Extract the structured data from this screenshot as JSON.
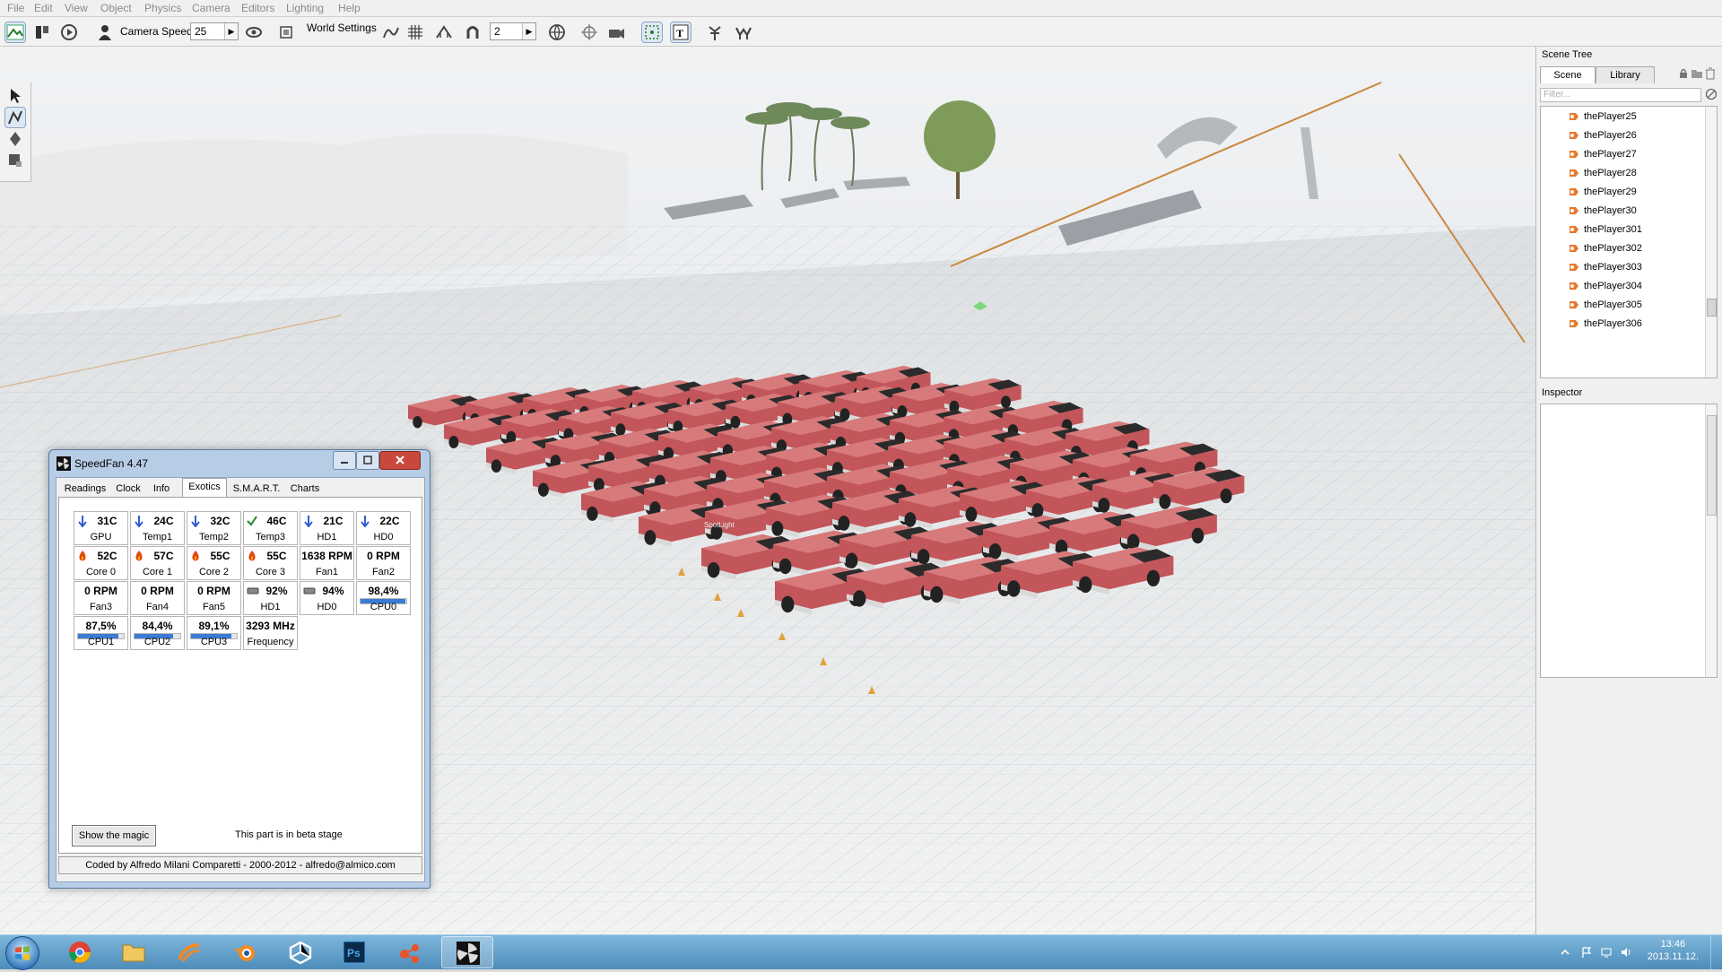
{
  "menu": [
    "File",
    "Edit",
    "View",
    "Object",
    "Physics",
    "Camera",
    "Editors",
    "Lighting",
    "Help"
  ],
  "toolbar": {
    "camera_speed_label": "Camera Speed",
    "camera_speed_value": "25",
    "world_settings_label": "World Settings",
    "grid_value": "2"
  },
  "viewport": {
    "light_label": "SpotLight"
  },
  "scene_tree": {
    "title": "Scene Tree",
    "tabs": [
      "Scene",
      "Library"
    ],
    "filter_placeholder": "Filter...",
    "items": [
      "thePlayer25",
      "thePlayer26",
      "thePlayer27",
      "thePlayer28",
      "thePlayer29",
      "thePlayer30",
      "thePlayer301",
      "thePlayer302",
      "thePlayer303",
      "thePlayer304",
      "thePlayer305",
      "thePlayer306"
    ]
  },
  "inspector": {
    "title": "Inspector"
  },
  "speedfan": {
    "title": "SpeedFan 4.47",
    "tabs": [
      "Readings",
      "Clock",
      "Info",
      "Exotics",
      "S.M.A.R.T.",
      "Charts"
    ],
    "active_tab": "Exotics",
    "cells": [
      {
        "value": "31C",
        "name": "GPU",
        "status": "down"
      },
      {
        "value": "24C",
        "name": "Temp1",
        "status": "down"
      },
      {
        "value": "32C",
        "name": "Temp2",
        "status": "down"
      },
      {
        "value": "46C",
        "name": "Temp3",
        "status": "ok"
      },
      {
        "value": "21C",
        "name": "HD1",
        "status": "down"
      },
      {
        "value": "22C",
        "name": "HD0",
        "status": "down"
      },
      {
        "value": "52C",
        "name": "Core 0",
        "status": "hot"
      },
      {
        "value": "57C",
        "name": "Core 1",
        "status": "hot"
      },
      {
        "value": "55C",
        "name": "Core 2",
        "status": "hot"
      },
      {
        "value": "55C",
        "name": "Core 3",
        "status": "hot"
      },
      {
        "value": "1638 RPM",
        "name": "Fan1",
        "status": "none"
      },
      {
        "value": "0 RPM",
        "name": "Fan2",
        "status": "none"
      },
      {
        "value": "0 RPM",
        "name": "Fan3",
        "status": "none"
      },
      {
        "value": "0 RPM",
        "name": "Fan4",
        "status": "none"
      },
      {
        "value": "0 RPM",
        "name": "Fan5",
        "status": "none"
      },
      {
        "value": "92%",
        "name": "HD1",
        "status": "disk"
      },
      {
        "value": "94%",
        "name": "HD0",
        "status": "disk"
      },
      {
        "value": "98,4%",
        "name": "CPU0",
        "status": "bar",
        "level": 0.984
      },
      {
        "value": "87,5%",
        "name": "CPU1",
        "status": "bar",
        "level": 0.875
      },
      {
        "value": "84,4%",
        "name": "CPU2",
        "status": "bar",
        "level": 0.844
      },
      {
        "value": "89,1%",
        "name": "CPU3",
        "status": "bar",
        "level": 0.891
      },
      {
        "value": "3293 MHz",
        "name": "Frequency",
        "status": "none"
      }
    ],
    "magic_button": "Show the magic",
    "beta_text": "This part is in beta stage",
    "status_text": "Coded by Alfredo Milani Comparetti - 2000-2012 - alfredo@almico.com"
  },
  "taskbar": {
    "apps": [
      "chrome-icon",
      "explorer-icon",
      "feed-icon",
      "blender-icon",
      "unity-icon",
      "photoshop-icon",
      "network-app-icon",
      "speedfan-icon"
    ],
    "active_app": "speedfan-icon",
    "time": "13:46",
    "date": "2013.11.12."
  },
  "colors": {
    "truck_red": "#c2565a",
    "status_down": "#1a4fd0",
    "status_ok": "#1f8a2a",
    "status_hot": "#e24a10",
    "cpu_bar": "#3a7bd5"
  }
}
